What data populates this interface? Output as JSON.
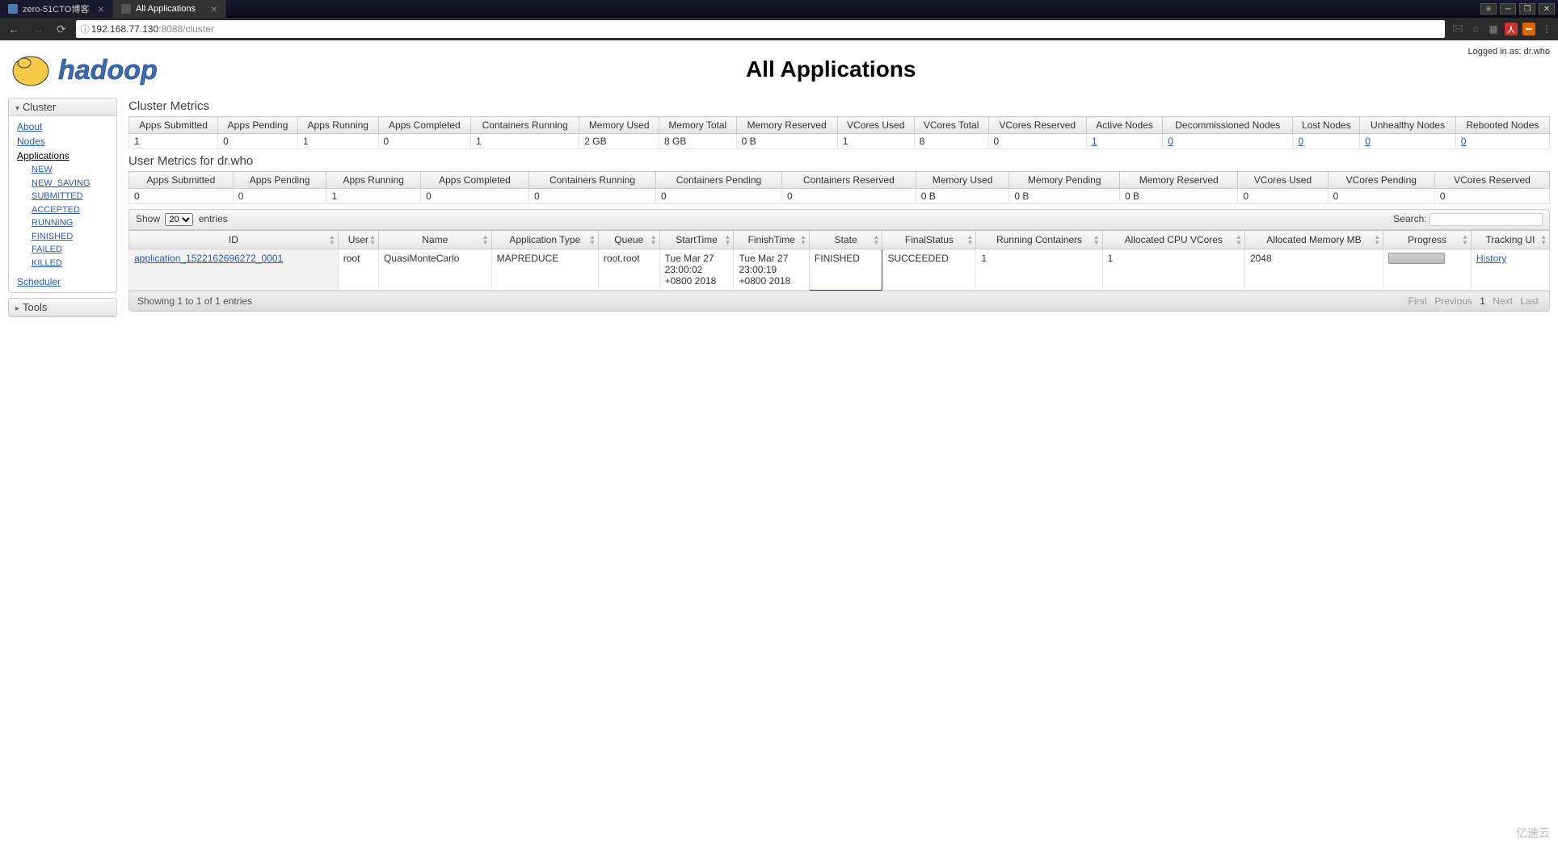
{
  "browser": {
    "tabs": [
      {
        "title": "zero-51CTO博客",
        "active": false
      },
      {
        "title": "All Applications",
        "active": true
      }
    ],
    "url_host": "192.168.77.130",
    "url_port": ":8088",
    "url_path": "/cluster"
  },
  "header": {
    "login_text": "Logged in as: dr.who",
    "page_title": "All Applications",
    "logo_text": "hadoop"
  },
  "sidebar": {
    "cluster_label": "Cluster",
    "tools_label": "Tools",
    "links": {
      "about": "About",
      "nodes": "Nodes",
      "applications": "Applications",
      "scheduler": "Scheduler"
    },
    "app_states": [
      "NEW",
      "NEW_SAVING",
      "SUBMITTED",
      "ACCEPTED",
      "RUNNING",
      "FINISHED",
      "FAILED",
      "KILLED"
    ]
  },
  "cluster_metrics": {
    "header": "Cluster Metrics",
    "cols": [
      "Apps Submitted",
      "Apps Pending",
      "Apps Running",
      "Apps Completed",
      "Containers Running",
      "Memory Used",
      "Memory Total",
      "Memory Reserved",
      "VCores Used",
      "VCores Total",
      "VCores Reserved",
      "Active Nodes",
      "Decommissioned Nodes",
      "Lost Nodes",
      "Unhealthy Nodes",
      "Rebooted Nodes"
    ],
    "row": [
      "1",
      "0",
      "1",
      "0",
      "1",
      "2 GB",
      "8 GB",
      "0 B",
      "1",
      "8",
      "0",
      "1",
      "0",
      "0",
      "0",
      "0"
    ],
    "links": [
      false,
      false,
      false,
      false,
      false,
      false,
      false,
      false,
      false,
      false,
      false,
      true,
      true,
      true,
      true,
      true
    ]
  },
  "user_metrics": {
    "header": "User Metrics for dr.who",
    "cols": [
      "Apps Submitted",
      "Apps Pending",
      "Apps Running",
      "Apps Completed",
      "Containers Running",
      "Containers Pending",
      "Containers Reserved",
      "Memory Used",
      "Memory Pending",
      "Memory Reserved",
      "VCores Used",
      "VCores Pending",
      "VCores Reserved"
    ],
    "row": [
      "0",
      "0",
      "1",
      "0",
      "0",
      "0",
      "0",
      "0 B",
      "0 B",
      "0 B",
      "0",
      "0",
      "0"
    ]
  },
  "data_table": {
    "show_label_pre": "Show",
    "show_label_post": "entries",
    "page_size": "20",
    "search_label": "Search:",
    "search_value": "",
    "cols": [
      "ID",
      "User",
      "Name",
      "Application Type",
      "Queue",
      "StartTime",
      "FinishTime",
      "State",
      "FinalStatus",
      "Running Containers",
      "Allocated CPU VCores",
      "Allocated Memory MB",
      "Progress",
      "Tracking UI"
    ],
    "row": {
      "id": "application_1522162696272_0001",
      "user": "root",
      "name": "QuasiMonteCarlo",
      "type": "MAPREDUCE",
      "queue": "root.root",
      "start": "Tue Mar 27 23:00:02 +0800 2018",
      "finish": "Tue Mar 27 23:00:19 +0800 2018",
      "state": "FINISHED",
      "final": "SUCCEEDED",
      "running": "1",
      "vcores": "1",
      "mem": "2048",
      "track": "History"
    },
    "footer_info": "Showing 1 to 1 of 1 entries",
    "pager": {
      "first": "First",
      "prev": "Previous",
      "cur": "1",
      "next": "Next",
      "last": "Last"
    }
  },
  "watermark": "亿速云"
}
